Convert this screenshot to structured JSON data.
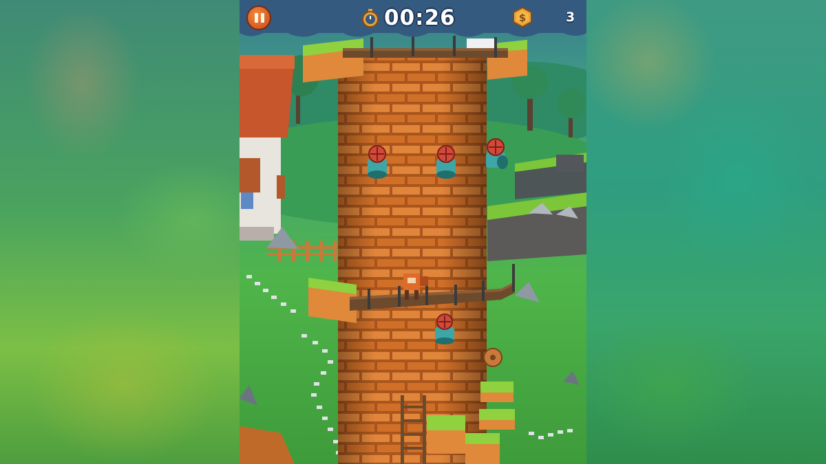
{
  "hud": {
    "pause_icon": "pause-icon",
    "timer_icon": "stopwatch-icon",
    "timer": "00:26",
    "coin_icon": "coin-icon",
    "coin_symbol": "$",
    "coins": "3"
  },
  "colors": {
    "hud_bar": "#345a80",
    "pause_button": "#e06a2a",
    "tower_brick": "#d6762c",
    "grass": "#7cc63a",
    "coin": "#e8a33a"
  }
}
